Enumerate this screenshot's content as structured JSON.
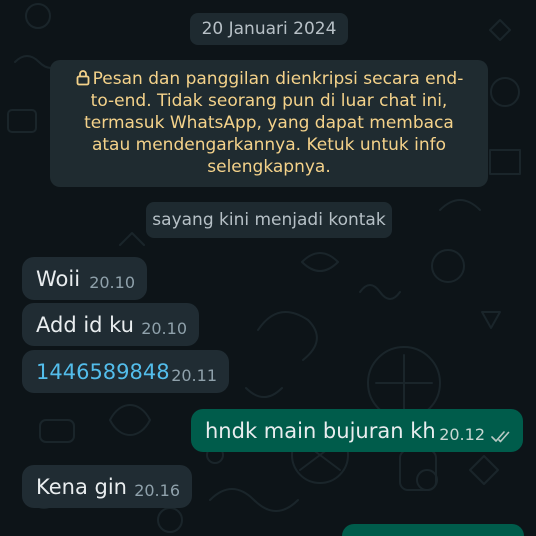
{
  "chat": {
    "date_label": "20 Januari 2024",
    "encryption_notice": "Pesan dan panggilan dienkripsi secara end-to-end. Tidak seorang pun di luar chat ini, termasuk WhatsApp, yang dapat membaca atau mendengarkannya. Ketuk untuk info selengkapnya.",
    "contact_notice": "sayang kini menjadi kontak",
    "messages": [
      {
        "direction": "incoming",
        "text": "Woii",
        "time": "20.10"
      },
      {
        "direction": "incoming",
        "text": "Add id ku",
        "time": "20.10"
      },
      {
        "direction": "incoming",
        "text": "1446589848",
        "time": "20.11",
        "is_link": true
      },
      {
        "direction": "outgoing",
        "text": "hndk main bujuran kh",
        "time": "20.12",
        "status": "read-double-check"
      },
      {
        "direction": "incoming",
        "text": "Kena gin",
        "time": "20.16"
      }
    ]
  },
  "colors": {
    "background": "#0d1418",
    "incoming_bubble": "#202c33",
    "outgoing_bubble": "#005c4b",
    "encryption_text": "#f4d28a",
    "link": "#53bdeb"
  }
}
